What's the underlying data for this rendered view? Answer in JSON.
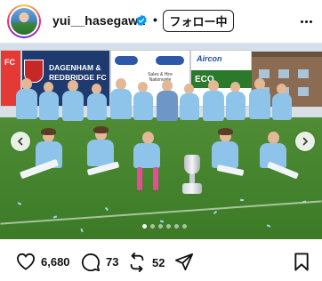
{
  "header": {
    "username": "yui__hasegawa",
    "separator": "•",
    "follow_label": "フォロー中"
  },
  "photo": {
    "boards": {
      "left_text": "FC",
      "dagenham_line1": "DAGENHAM &",
      "dagenham_line2": "REDBRIDGE FC",
      "mid_chip1": "",
      "mid_chip2": "",
      "mid_sales": "Sales & Hire Nationwide",
      "right_brand": "Aircon",
      "right_eco": "ECO"
    },
    "carousel": {
      "total": 6,
      "active_index": 0
    }
  },
  "actions": {
    "like_count": "6,680",
    "comment_count": "73",
    "repost_count": "52"
  },
  "colors": {
    "verified": "#0095f6",
    "accent_sky_blue": "#8fc4ea"
  }
}
